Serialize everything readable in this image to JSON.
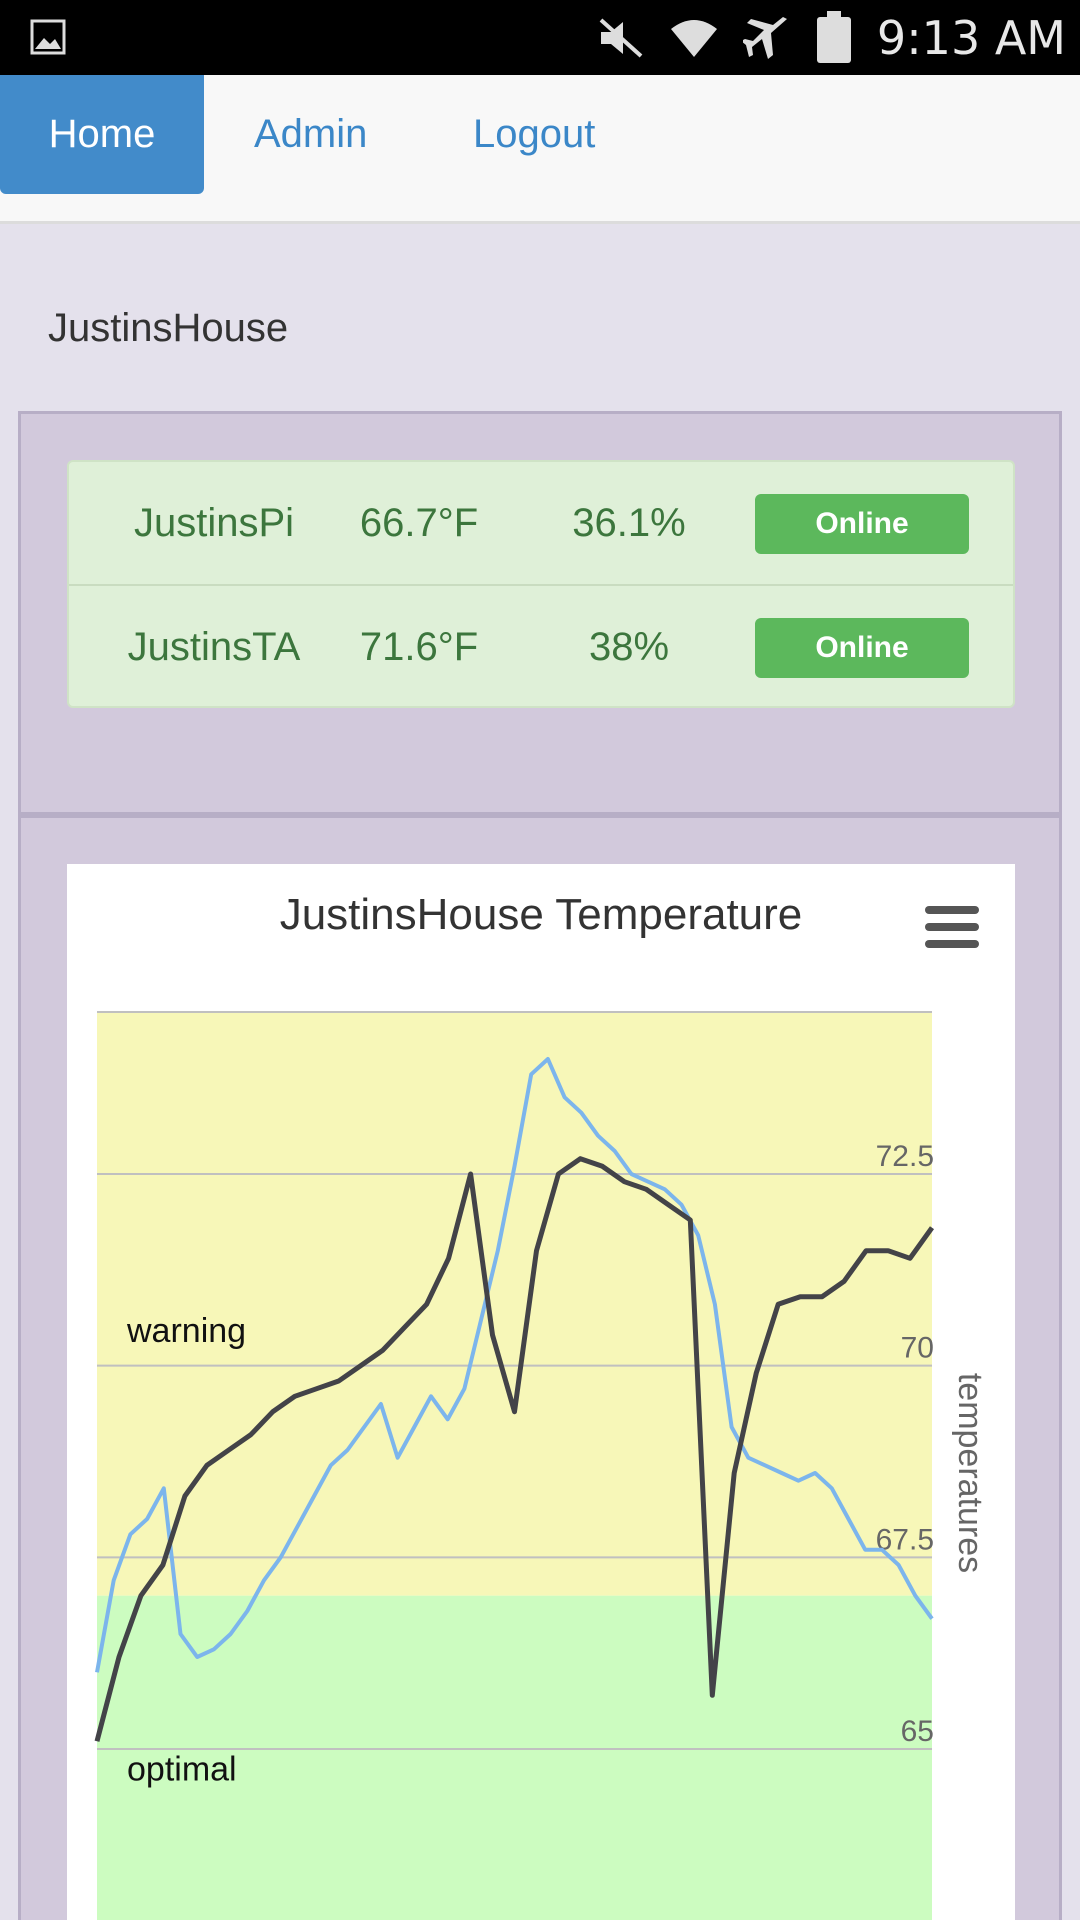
{
  "status_bar": {
    "time": "9:13 AM",
    "icons": [
      "image-icon",
      "mute-icon",
      "wifi-icon",
      "airplane-icon",
      "battery-icon"
    ]
  },
  "nav": {
    "home": "Home",
    "admin": "Admin",
    "logout": "Logout"
  },
  "house_name": "JustinsHouse",
  "devices": [
    {
      "name": "JustinsPi",
      "temp": "66.7°F",
      "humidity": "36.1%",
      "status": "Online"
    },
    {
      "name": "JustinsTA",
      "temp": "71.6°F",
      "humidity": "38%",
      "status": "Online"
    }
  ],
  "colors": {
    "primary": "#428bca",
    "success": "#5cb85c",
    "warning_band": "#f7f7b8",
    "optimal_band": "#ccfcc0",
    "series_light": "#7cb5ec",
    "series_dark": "#434348"
  },
  "chart_data": {
    "type": "line",
    "title": "JustinsHouse Temperature",
    "ylabel": "temperatures",
    "ylim": [
      62.7,
      75
    ],
    "yticks": [
      65,
      67.5,
      70,
      72.5
    ],
    "plot_bands": [
      {
        "label": "warning",
        "from": 67,
        "to": 75
      },
      {
        "label": "optimal",
        "from": 62.7,
        "to": 67
      }
    ],
    "series": [
      {
        "values": [
          66.0,
          67.2,
          67.8,
          68.0,
          68.4,
          66.5,
          66.2,
          66.3,
          66.5,
          66.8,
          67.2,
          67.5,
          67.9,
          68.3,
          68.7,
          68.9,
          69.2,
          69.5,
          68.8,
          69.2,
          69.6,
          69.3,
          69.7,
          70.6,
          71.5,
          72.6,
          73.8,
          74.0,
          73.5,
          73.3,
          73.0,
          72.8,
          72.5,
          72.4,
          72.3,
          72.1,
          71.7,
          70.8,
          69.2,
          68.8,
          68.7,
          68.6,
          68.5,
          68.6,
          68.4,
          68.0,
          67.6,
          67.6,
          67.4,
          67.0,
          66.7
        ]
      },
      {
        "values": [
          65.1,
          66.2,
          67.0,
          67.4,
          68.3,
          68.7,
          68.9,
          69.1,
          69.4,
          69.6,
          69.7,
          69.8,
          70.0,
          70.2,
          70.5,
          70.8,
          71.4,
          72.5,
          70.4,
          69.4,
          71.5,
          72.5,
          72.7,
          72.6,
          72.4,
          72.3,
          72.1,
          71.9,
          65.7,
          68.6,
          69.9,
          70.8,
          70.9,
          70.9,
          71.1,
          71.5,
          71.5,
          71.4,
          71.8
        ]
      }
    ]
  }
}
